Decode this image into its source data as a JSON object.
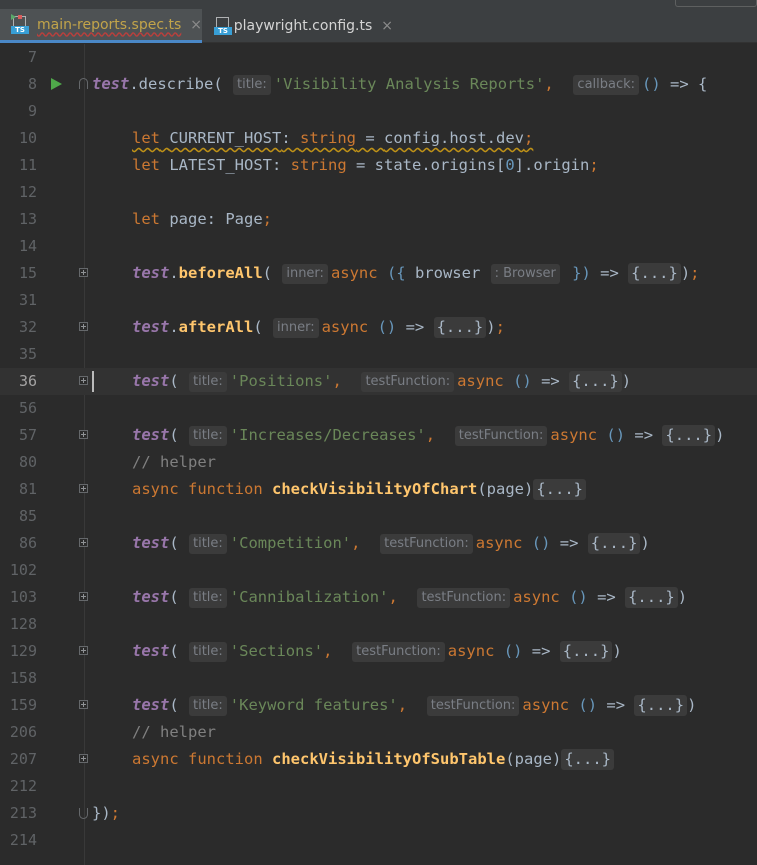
{
  "tabs": [
    {
      "label": "main-reports.spec.ts",
      "icon": "typescript-test-file-icon",
      "active": true
    },
    {
      "label": "playwright.config.ts",
      "icon": "typescript-file-icon",
      "active": false
    }
  ],
  "ts_badge": "TS",
  "close_glyph": "×",
  "fold_placeholder": "{...}",
  "editor": {
    "current_line": "36",
    "lines": [
      {
        "num": "7"
      },
      {
        "num": "8",
        "test_kw": "test",
        "method": "describe",
        "hint_title": "title:",
        "title": "'Visibility Analysis Reports'",
        "hint_callback": "callback:"
      },
      {
        "num": "9"
      },
      {
        "num": "10",
        "let_kw": "let",
        "name": "CURRENT_HOST",
        "type": "string",
        "value": "config.host.dev"
      },
      {
        "num": "11",
        "let_kw": "let",
        "name": "LATEST_HOST",
        "type": "string",
        "value_pre": "state.origins[",
        "index": "0",
        "value_post": "].origin"
      },
      {
        "num": "12"
      },
      {
        "num": "13",
        "let_kw": "let",
        "name": "page",
        "type": "Page"
      },
      {
        "num": "14"
      },
      {
        "num": "15",
        "test_kw": "test",
        "method": "beforeAll",
        "hint_inner": "inner:",
        "async_kw": "async",
        "param": "browser",
        "hint_type": ": Browser"
      },
      {
        "num": "31"
      },
      {
        "num": "32",
        "test_kw": "test",
        "method": "afterAll",
        "hint_inner": "inner:",
        "async_kw": "async"
      },
      {
        "num": "35"
      },
      {
        "num": "36",
        "test_kw": "test",
        "hint_title": "title:",
        "title": "'Positions'",
        "hint_fn": "testFunction:",
        "async_kw": "async"
      },
      {
        "num": "56"
      },
      {
        "num": "57",
        "test_kw": "test",
        "hint_title": "title:",
        "title": "'Increases/Decreases'",
        "hint_fn": "testFunction:",
        "async_kw": "async"
      },
      {
        "num": "80",
        "comment": "// helper"
      },
      {
        "num": "81",
        "async_kw": "async",
        "function_kw": "function",
        "fn_name": "checkVisibilityOfChart",
        "param": "page"
      },
      {
        "num": "85"
      },
      {
        "num": "86",
        "test_kw": "test",
        "hint_title": "title:",
        "title": "'Competition'",
        "hint_fn": "testFunction:",
        "async_kw": "async"
      },
      {
        "num": "102"
      },
      {
        "num": "103",
        "test_kw": "test",
        "hint_title": "title:",
        "title": "'Cannibalization'",
        "hint_fn": "testFunction:",
        "async_kw": "async"
      },
      {
        "num": "128"
      },
      {
        "num": "129",
        "test_kw": "test",
        "hint_title": "title:",
        "title": "'Sections'",
        "hint_fn": "testFunction:",
        "async_kw": "async"
      },
      {
        "num": "158"
      },
      {
        "num": "159",
        "test_kw": "test",
        "hint_title": "title:",
        "title": "'Keyword features'",
        "hint_fn": "testFunction:",
        "async_kw": "async"
      },
      {
        "num": "206",
        "comment": "// helper"
      },
      {
        "num": "207",
        "async_kw": "async",
        "function_kw": "function",
        "fn_name": "checkVisibilityOfSubTable",
        "param": "page"
      },
      {
        "num": "212"
      },
      {
        "num": "213",
        "closing": "});"
      },
      {
        "num": "214"
      }
    ]
  },
  "colors": {
    "background": "#2b2b2b",
    "keyword": "#cc7832",
    "function": "#ffc66d",
    "object": "#9876aa",
    "string": "#6a8759",
    "number": "#6897bb",
    "comment": "#808080",
    "text": "#a9b7c6",
    "run_icon": "#4fa84a",
    "tab_accent": "#4a88c7"
  }
}
